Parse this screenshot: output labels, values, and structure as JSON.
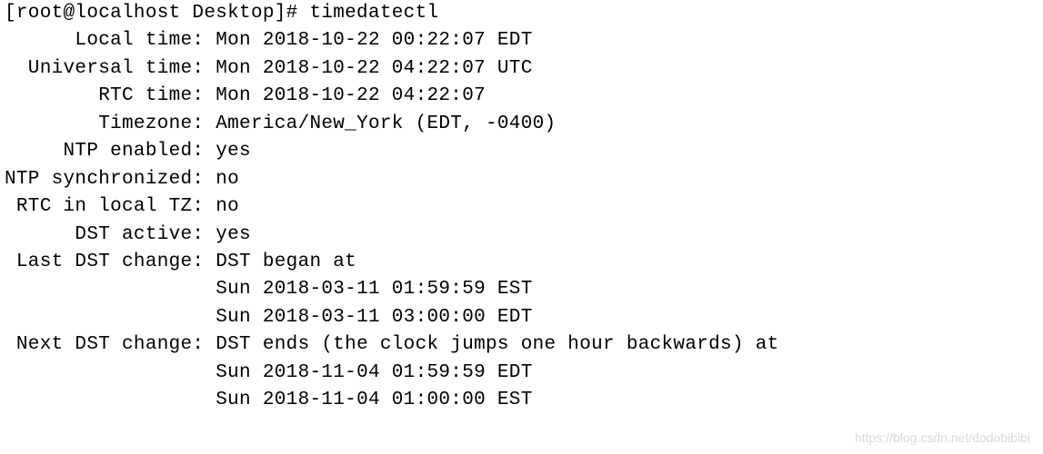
{
  "terminal": {
    "prompt": "[root@localhost Desktop]# ",
    "command": "timedatectl",
    "labels": {
      "local_time": "      Local time: ",
      "universal_time": "  Universal time: ",
      "rtc_time": "        RTC time: ",
      "timezone": "        Timezone: ",
      "ntp_enabled": "     NTP enabled: ",
      "ntp_synced": "NTP synchronized: ",
      "rtc_in_local": " RTC in local TZ: ",
      "dst_active": "      DST active: ",
      "last_dst_change": " Last DST change: ",
      "next_dst_change": " Next DST change: ",
      "indent": "                  "
    },
    "values": {
      "local_time": "Mon 2018-10-22 00:22:07 EDT",
      "universal_time": "Mon 2018-10-22 04:22:07 UTC",
      "rtc_time": "Mon 2018-10-22 04:22:07",
      "timezone": "America/New_York (EDT, -0400)",
      "ntp_enabled": "yes",
      "ntp_synced": "no",
      "rtc_in_local": "no",
      "dst_active": "yes",
      "last_dst_change_msg": "DST began at",
      "last_dst_change_line1": "Sun 2018-03-11 01:59:59 EST",
      "last_dst_change_line2": "Sun 2018-03-11 03:00:00 EDT",
      "next_dst_change_msg": "DST ends (the clock jumps one hour backwards) at",
      "next_dst_change_line1": "Sun 2018-11-04 01:59:59 EDT",
      "next_dst_change_line2": "Sun 2018-11-04 01:00:00 EST"
    }
  },
  "watermark": "https://blog.csdn.net/dodobibibi"
}
